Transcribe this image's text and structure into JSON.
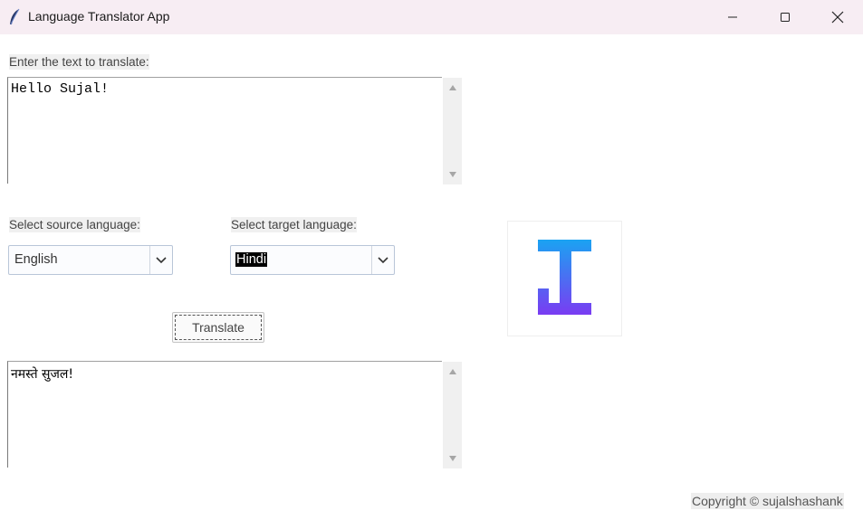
{
  "window": {
    "title": "Language Translator App",
    "controls": [
      "minimize",
      "maximize",
      "close"
    ]
  },
  "input": {
    "label": "Enter the text to translate:",
    "value": "Hello Sujal!"
  },
  "source_language": {
    "label": "Select source language:",
    "selected": "English"
  },
  "target_language": {
    "label": "Select target language:",
    "selected": "Hindi"
  },
  "translate_button": {
    "label": "Translate"
  },
  "output": {
    "value": "नमस्ते सुजल!"
  },
  "footer": {
    "copyright": "Copyright © sujalshashank"
  },
  "colors": {
    "titlebar": "#f7edf3",
    "logo_gradient_start": "#1aa3f2",
    "logo_gradient_end": "#7a3cf2"
  },
  "icons": {
    "app": "feather-icon",
    "logo": "translator-logo"
  }
}
